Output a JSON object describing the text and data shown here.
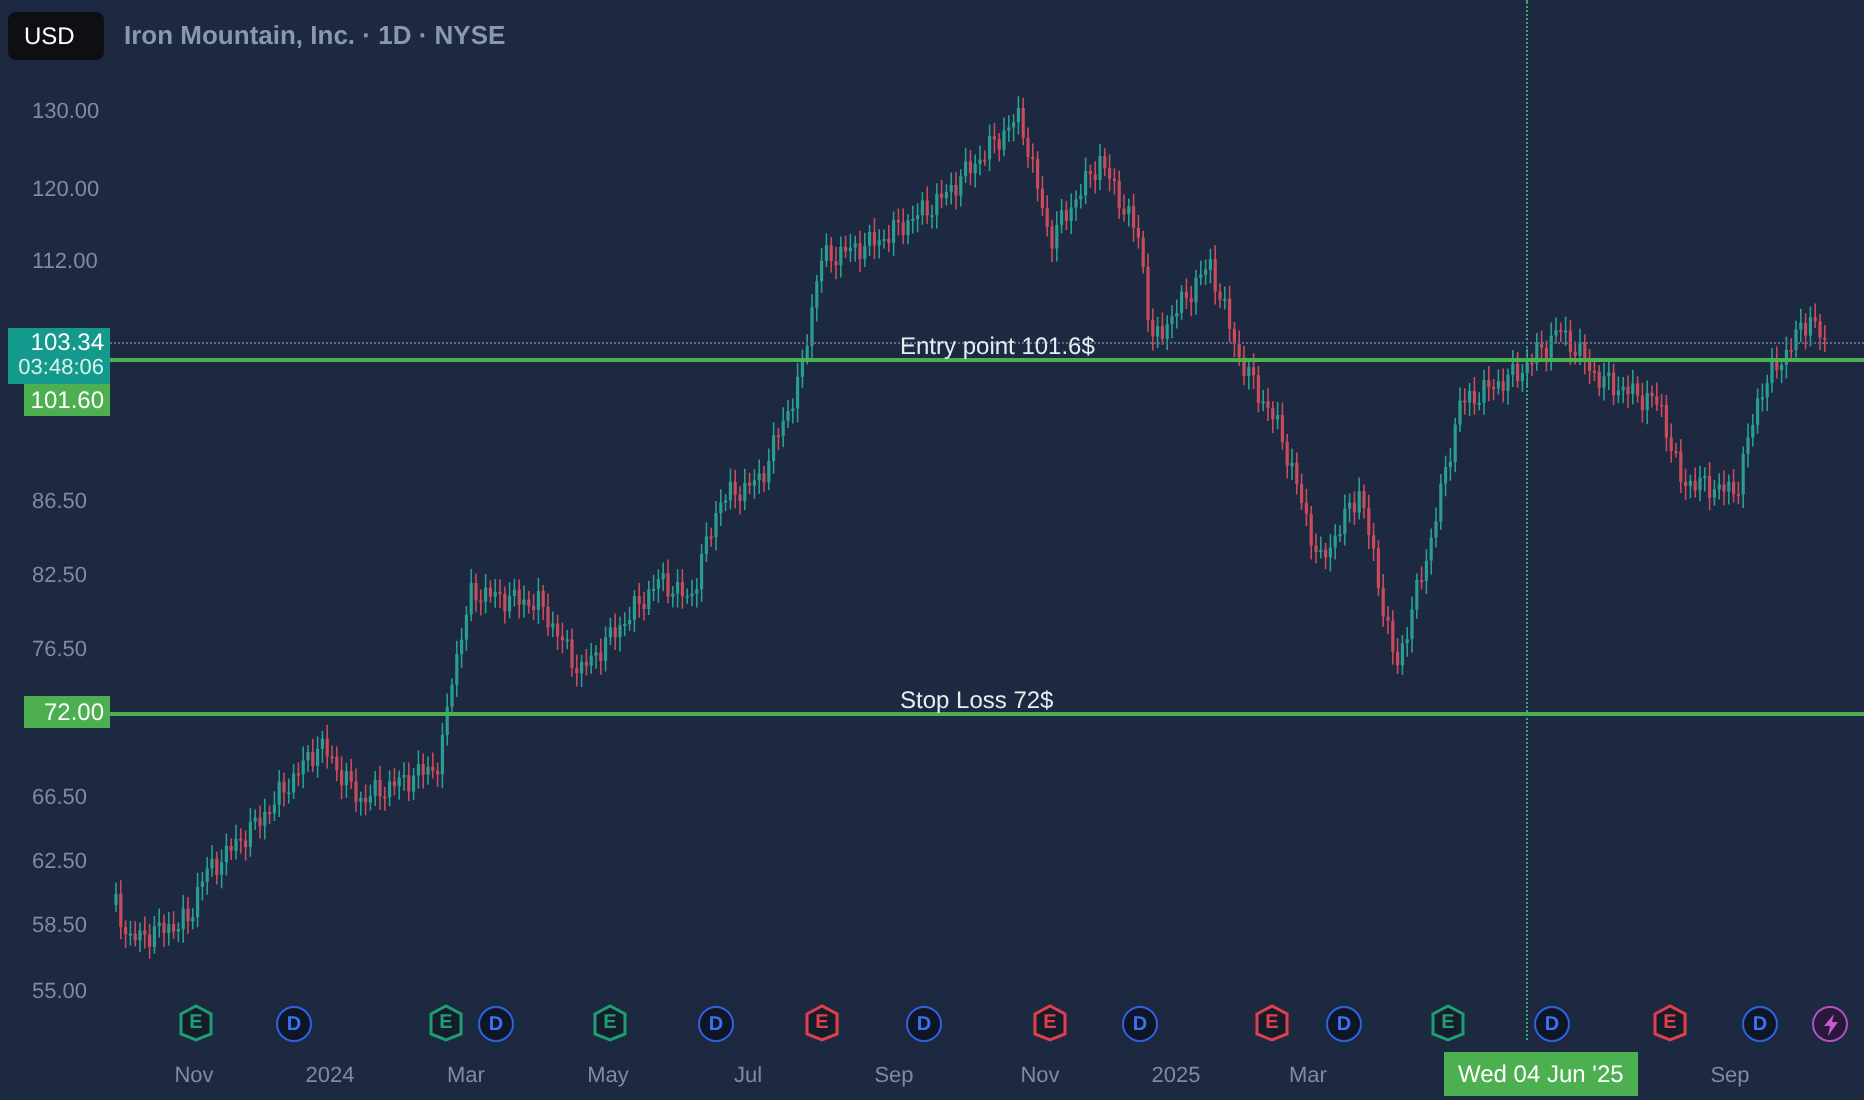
{
  "header": {
    "currency": "USD",
    "title": "Iron Mountain, Inc. · 1D · NYSE"
  },
  "price_axis": [
    "130.00",
    "120.00",
    "112.00",
    "86.50",
    "82.50",
    "76.50",
    "66.50",
    "62.50",
    "58.50",
    "55.00"
  ],
  "price_tags": [
    {
      "kind": "last",
      "price": "103.34",
      "countdown": "03:48:06"
    },
    {
      "kind": "entry",
      "price": "101.60"
    },
    {
      "kind": "stop",
      "price": "72.00"
    }
  ],
  "lines": [
    {
      "kind": "entry",
      "label": "Entry point 101.6$"
    },
    {
      "kind": "stop",
      "label": "Stop Loss 72$"
    }
  ],
  "events": [
    {
      "kind": "earnings",
      "letter": "E",
      "color": "#1e9e72"
    },
    {
      "kind": "dividend",
      "letter": "D"
    },
    {
      "kind": "earnings",
      "letter": "E",
      "color": "#1e9e72"
    },
    {
      "kind": "dividend",
      "letter": "D"
    },
    {
      "kind": "earnings",
      "letter": "E",
      "color": "#1e9e72"
    },
    {
      "kind": "dividend",
      "letter": "D"
    },
    {
      "kind": "earnings",
      "letter": "E",
      "color": "#e0404e"
    },
    {
      "kind": "dividend",
      "letter": "D"
    },
    {
      "kind": "earnings",
      "letter": "E",
      "color": "#e0404e"
    },
    {
      "kind": "dividend",
      "letter": "D"
    },
    {
      "kind": "earnings",
      "letter": "E",
      "color": "#e0404e"
    },
    {
      "kind": "dividend",
      "letter": "D"
    },
    {
      "kind": "earnings",
      "letter": "E",
      "color": "#1e9e72"
    },
    {
      "kind": "dividend",
      "letter": "D"
    },
    {
      "kind": "earnings",
      "letter": "E",
      "color": "#e0404e"
    },
    {
      "kind": "dividend",
      "letter": "D"
    },
    {
      "kind": "split"
    }
  ],
  "time_axis": [
    "Nov",
    "2024",
    "Mar",
    "May",
    "Jul",
    "Sep",
    "Nov",
    "2025",
    "Mar",
    "Sep"
  ],
  "crosshair_date": "Wed 04 Jun '25"
}
